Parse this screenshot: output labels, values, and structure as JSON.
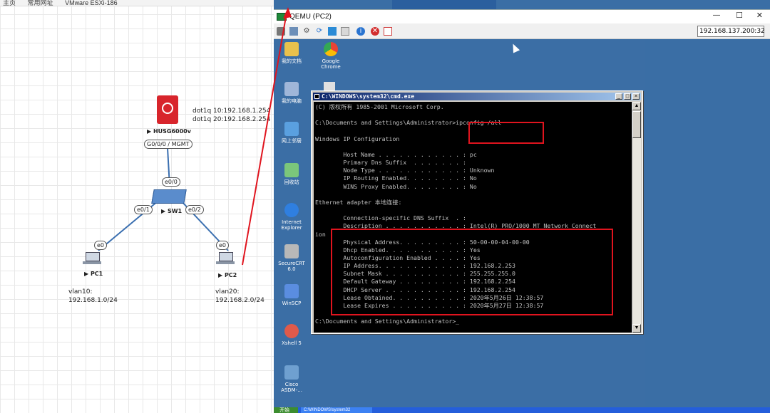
{
  "bookmarks": {
    "items": [
      "主页",
      "常用网址",
      "VMware ESXi-186"
    ]
  },
  "topology": {
    "firewall": {
      "label": "▶ HUSG6000v",
      "port": "G0/0/0 / MGMT",
      "dot1q_lines": [
        "dot1q 10:192.168.1.254",
        "dot1q 20:192.168.2.254"
      ]
    },
    "switch": {
      "label": "▶ SW1",
      "port_up": "e0/0",
      "port_left": "e0/1",
      "port_right": "e0/2"
    },
    "pc1": {
      "label": "▶ PC1",
      "port": "e0",
      "vlan": "vlan10:",
      "subnet": "192.168.1.0/24"
    },
    "pc2": {
      "label": "▶ PC2",
      "port": "e0",
      "vlan": "vlan20:",
      "subnet": "192.168.2.0/24"
    }
  },
  "qemu": {
    "title": "QEMU (PC2)",
    "ip_field": "192.168.137.200:32",
    "controls": {
      "minimize": "—",
      "maximize": "☐",
      "close": "✕"
    },
    "accent": "#e0141e"
  },
  "desktop_icons": [
    {
      "label": "我的文档",
      "color": "#e9c14c"
    },
    {
      "label": "Google Chrome",
      "color": "#ea4335"
    },
    {
      "label": "我的电脑",
      "color": "#9fb6d9"
    },
    {
      "label": "网上邻居",
      "color": "#5aa0e0"
    },
    {
      "label": "回收站",
      "color": "#7bc67b"
    },
    {
      "label": "Internet Explorer",
      "color": "#2f7fe0"
    },
    {
      "label": "SecureCRT 6.0",
      "color": "#b8b8b8"
    },
    {
      "label": "WinSCP",
      "color": "#5a8de0"
    },
    {
      "label": "Xshell 5",
      "color": "#e05a4a"
    },
    {
      "label": "Cisco ASDM-...",
      "color": "#6fa0d0"
    }
  ],
  "cmd": {
    "title": "C:\\WINDOWS\\system32\\cmd.exe",
    "lines": [
      "(C) 版权所有 1985-2001 Microsoft Corp.",
      "",
      "C:\\Documents and Settings\\Administrator>ipconfig /all",
      "",
      "Windows IP Configuration",
      "",
      "        Host Name . . . . . . . . . . . . : pc",
      "        Primary Dns Suffix  . . . . . . . :",
      "        Node Type . . . . . . . . . . . . : Unknown",
      "        IP Routing Enabled. . . . . . . . : No",
      "        WINS Proxy Enabled. . . . . . . . : No",
      "",
      "Ethernet adapter 本地连接:",
      "",
      "        Connection-specific DNS Suffix  . :",
      "        Description . . . . . . . . . . . : Intel(R) PRO/1000 MT Network Connect",
      "ion",
      "        Physical Address. . . . . . . . . : 50-00-00-04-00-00",
      "        Dhcp Enabled. . . . . . . . . . . : Yes",
      "        Autoconfiguration Enabled . . . . : Yes",
      "        IP Address. . . . . . . . . . . . : 192.168.2.253",
      "        Subnet Mask . . . . . . . . . . . : 255.255.255.0",
      "        Default Gateway . . . . . . . . . : 192.168.2.254",
      "        DHCP Server . . . . . . . . . . . : 192.168.2.254",
      "        Lease Obtained. . . . . . . . . . : 2020年5月26日 12:38:57",
      "        Lease Expires . . . . . . . . . . : 2020年5月27日 12:38:57",
      "",
      "C:\\Documents and Settings\\Administrator>_"
    ]
  },
  "taskbar": {
    "start": "开始",
    "task": "C:\\WINDOWS\\system32"
  }
}
